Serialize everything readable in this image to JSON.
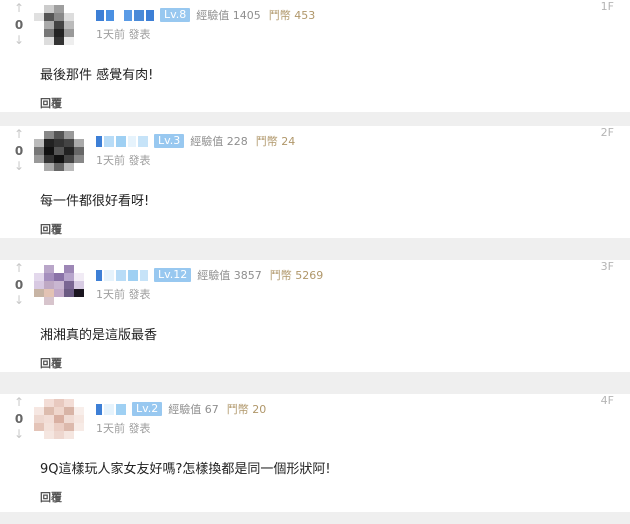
{
  "comments": [
    {
      "votes": "0",
      "level": "Lv.8",
      "exp": "經驗值 1405",
      "coins": "鬥幣 453",
      "time": "1天前  發表",
      "floor": "1F",
      "text": "最後那件 感覺有肉!",
      "reply_label": "回覆"
    },
    {
      "votes": "0",
      "level": "Lv.3",
      "exp": "經驗值 228",
      "coins": "鬥幣 24",
      "time": "1天前  發表",
      "floor": "2F",
      "text": "每一件都很好看呀!",
      "reply_label": "回覆"
    },
    {
      "votes": "0",
      "level": "Lv.12",
      "exp": "經驗值 3857",
      "coins": "鬥幣 5269",
      "time": "1天前  發表",
      "floor": "3F",
      "text": "湘湘真的是這版最香",
      "reply_label": "回覆"
    },
    {
      "votes": "0",
      "level": "Lv.2",
      "exp": "經驗值 67",
      "coins": "鬥幣 20",
      "time": "1天前  發表",
      "floor": "4F",
      "text": "9Q這樣玩人家女友好嗎?怎樣換都是同一個形狀阿!",
      "reply_label": "回覆"
    }
  ]
}
